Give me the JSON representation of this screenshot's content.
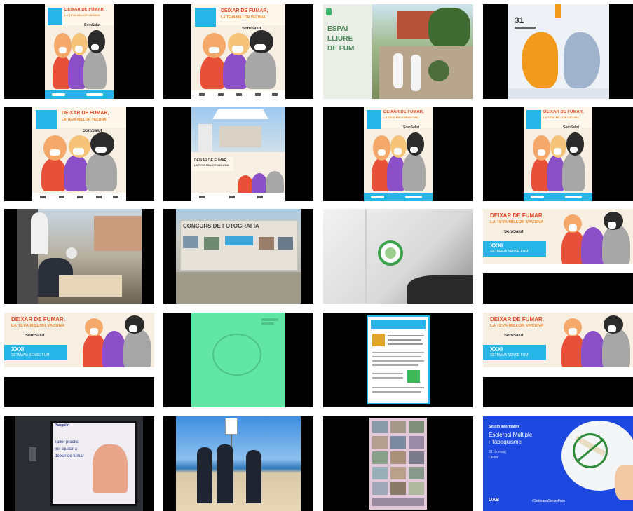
{
  "poster": {
    "title_line1": "DEIXAR DE FUMAR,",
    "title_line2": "LA TEVA MILLOR VACUNA",
    "brand": "SomSalut",
    "week": "XXXI",
    "week_sub": "SETMANA SENSE FUM"
  },
  "photo_banner": {
    "line1": "ESPAI",
    "line2": "LLIURE",
    "line3": "DE FUM"
  },
  "lung_poster": {
    "day": "31"
  },
  "exhibition": {
    "banner": "CONCURS DE FOTOGRAFIA"
  },
  "presentation": {
    "brand": "Pangolin",
    "slide_text_1": "Taller pràctic",
    "slide_text_2": "per ajudar a",
    "slide_text_3": "deixar de fumar"
  },
  "webinar": {
    "kicker": "Sessió informativa",
    "title_1": "Esclerosi Múltiple",
    "title_2": "i Tabaquisme",
    "date": "31 de maig",
    "time": "Online",
    "hashtag": "#SetmanaSenseFum",
    "logo": "UAB"
  },
  "colors": {
    "poster_bg": "#f7efe1",
    "accent_blue": "#27b4e6",
    "accent_red": "#e04b2a",
    "accent_orange": "#f08a2c",
    "lung_orange": "#f29a1c",
    "green_card": "#62e6a5",
    "webinar_blue": "#1d49e0"
  }
}
